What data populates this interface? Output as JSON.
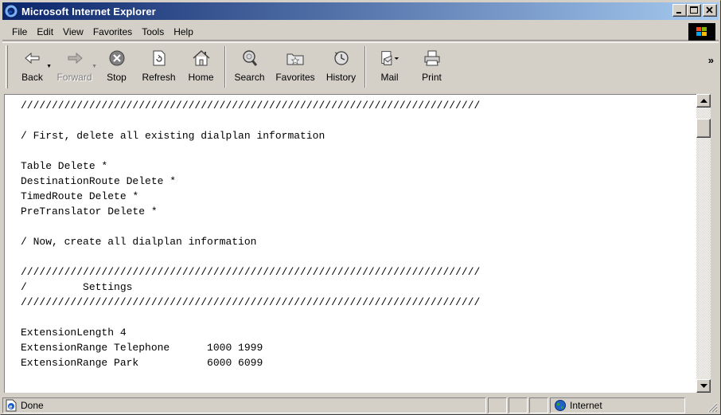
{
  "window": {
    "title": "Microsoft Internet Explorer"
  },
  "menu": [
    "File",
    "Edit",
    "View",
    "Favorites",
    "Tools",
    "Help"
  ],
  "toolbar": {
    "back": "Back",
    "forward": "Forward",
    "stop": "Stop",
    "refresh": "Refresh",
    "home": "Home",
    "search": "Search",
    "favorites": "Favorites",
    "history": "History",
    "mail": "Mail",
    "print": "Print",
    "more": "»"
  },
  "content": {
    "lines": [
      "//////////////////////////////////////////////////////////////////////////",
      "",
      "/ First, delete all existing dialplan information",
      "",
      "Table Delete *",
      "DestinationRoute Delete *",
      "TimedRoute Delete *",
      "PreTranslator Delete *",
      "",
      "/ Now, create all dialplan information",
      "",
      "//////////////////////////////////////////////////////////////////////////",
      "/         Settings",
      "//////////////////////////////////////////////////////////////////////////",
      "",
      "ExtensionLength 4",
      "ExtensionRange Telephone      1000 1999",
      "ExtensionRange Park           6000 6099"
    ]
  },
  "status": {
    "text": "Done",
    "zone": "Internet"
  },
  "colors": {
    "title_start": "#0a246a",
    "title_end": "#a6caf0",
    "chrome": "#d4d0c8"
  }
}
